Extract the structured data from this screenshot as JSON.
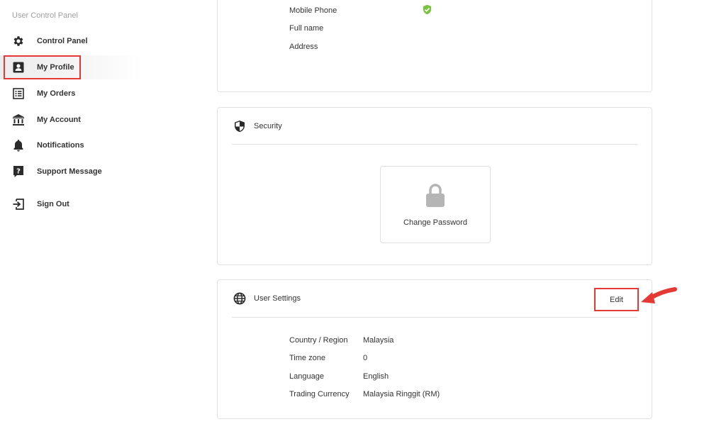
{
  "sidebar": {
    "heading": "User Control Panel",
    "items": [
      {
        "label": "Control Panel",
        "icon": "gear-icon"
      },
      {
        "label": "My Profile",
        "icon": "profile-card-icon"
      },
      {
        "label": "My Orders",
        "icon": "order-list-icon"
      },
      {
        "label": "My Account",
        "icon": "bank-icon"
      },
      {
        "label": "Notifications",
        "icon": "bell-icon"
      },
      {
        "label": "Support Message",
        "icon": "question-icon"
      },
      {
        "label": "Sign Out",
        "icon": "sign-out-icon"
      }
    ],
    "active_item": "My Profile"
  },
  "profile": {
    "fields": [
      {
        "label": "Mobile Phone",
        "verified": true
      },
      {
        "label": "Full name"
      },
      {
        "label": "Address"
      }
    ]
  },
  "security": {
    "title": "Security",
    "change_password_label": "Change Password"
  },
  "user_settings": {
    "title": "User Settings",
    "edit_label": "Edit",
    "fields": [
      {
        "label": "Country / Region",
        "value": "Malaysia"
      },
      {
        "label": "Time zone",
        "value": "0"
      },
      {
        "label": "Language",
        "value": "English"
      },
      {
        "label": "Trading Currency",
        "value": "Malaysia Ringgit (RM)"
      }
    ]
  },
  "colors": {
    "highlight": "#e53935",
    "verified": "#7cc242",
    "icon_dark": "#2b2b2b",
    "lock_gray": "#b5b5b5"
  }
}
